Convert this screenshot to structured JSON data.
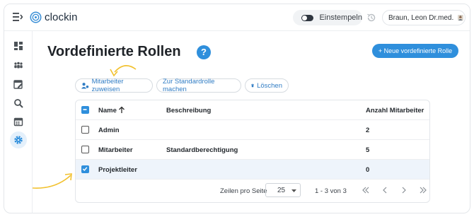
{
  "app": {
    "name": "clockin"
  },
  "header": {
    "clock_in_label": "Einstempeln",
    "user_name": "Braun, Leon Dr.med."
  },
  "sidebar": {
    "items": [
      {
        "icon": "dashboard-icon"
      },
      {
        "icon": "team-icon"
      },
      {
        "icon": "calendar-edit-icon"
      },
      {
        "icon": "search-document-icon"
      },
      {
        "icon": "calendar-icon"
      },
      {
        "icon": "settings-gear-icon",
        "active": true
      }
    ]
  },
  "page": {
    "title": "Vordefinierte Rollen",
    "help": "?",
    "new_button": "+ Neue vordefinierte Rolle"
  },
  "actions": {
    "assign": "Mitarbeiter zuweisen",
    "default": "Zur Standardrolle machen",
    "delete": "Löschen"
  },
  "table": {
    "columns": {
      "name": "Name",
      "description": "Beschreibung",
      "count": "Anzahl Mitarbeiter"
    },
    "rows": [
      {
        "name": "Admin",
        "description": "",
        "count": "2",
        "checked": false
      },
      {
        "name": "Mitarbeiter",
        "description": "Standardberechtigung",
        "count": "5",
        "checked": false
      },
      {
        "name": "Projektleiter",
        "description": "",
        "count": "0",
        "checked": true
      }
    ]
  },
  "pagination": {
    "rows_per_page_label": "Zeilen pro Seite",
    "rows_per_page": "25",
    "range": "1 - 3 von 3"
  },
  "colors": {
    "accent": "#2f8fdc",
    "highlight_arrow": "#f2c12e"
  }
}
